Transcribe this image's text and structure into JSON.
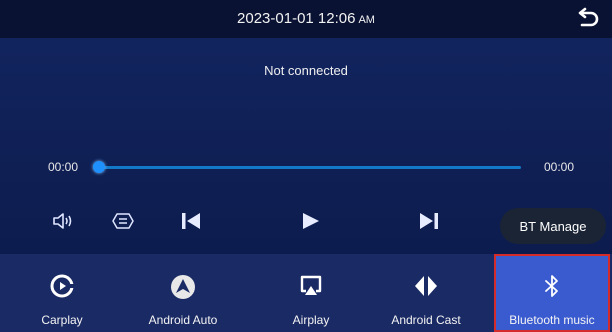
{
  "header": {
    "date_time": "2023-01-01 12:06",
    "am_pm": "AM",
    "back_icon": "back-arrow-icon"
  },
  "player": {
    "status": "Not connected",
    "elapsed": "00:00",
    "duration": "00:00",
    "progress": 0,
    "controls": [
      "volume-icon",
      "eq-icon",
      "previous-icon",
      "play-icon",
      "next-icon"
    ],
    "bt_manage_label": "BT Manage"
  },
  "tabs": [
    {
      "label": "Carplay",
      "icon": "carplay-icon"
    },
    {
      "label": "Android Auto",
      "icon": "android-auto-icon"
    },
    {
      "label": "Airplay",
      "icon": "airplay-icon"
    },
    {
      "label": "Android Cast",
      "icon": "android-cast-icon"
    },
    {
      "label": "Bluetooth music",
      "icon": "bluetooth-icon",
      "selected": true
    }
  ],
  "colors": {
    "background": "#0e1a4a",
    "accent": "#1e90ff",
    "active_tab": "#3a5bd0",
    "selection_outline": "#d52b2b"
  }
}
